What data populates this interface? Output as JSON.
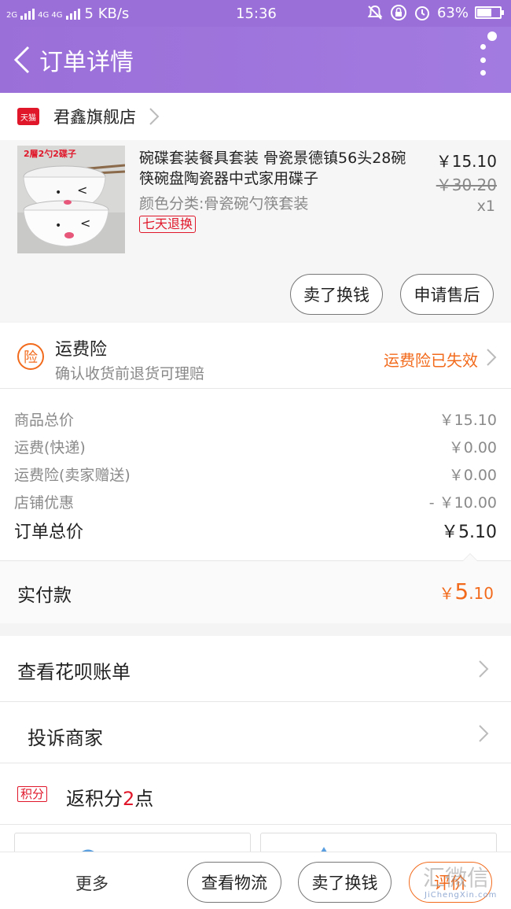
{
  "status_bar": {
    "network_a": "2G",
    "network_b": "4G 4G",
    "speed": "5 KB/s",
    "time": "15:36",
    "battery": "63%",
    "battery_level": 0.63
  },
  "header": {
    "title": "订单详情"
  },
  "store": {
    "badge": "天猫",
    "name": "君鑫旗舰店"
  },
  "product": {
    "title": "碗碟套装餐具套装 骨瓷景德镇56头28碗筷碗盘陶瓷器中式家用碟子",
    "sku": "颜色分类:骨瓷碗勺筷套装",
    "tag": "七天退换",
    "thumb_caption": "2層2勺2碟子",
    "price": "￥15.10",
    "original_price": "￥30.20",
    "quantity": "x1",
    "btn_sell": "卖了换钱",
    "btn_aftersale": "申请售后"
  },
  "insurance": {
    "icon": "险",
    "title": "运费险",
    "subtitle": "确认收货前退货可理赔",
    "status": "运费险已失效"
  },
  "summary": {
    "rows": [
      {
        "label": "商品总价",
        "value": "￥15.10"
      },
      {
        "label": "运费(快递)",
        "value": "￥0.00"
      },
      {
        "label": "运费险(卖家赠送)",
        "value": "￥0.00"
      },
      {
        "label": "店铺优惠",
        "value": "- ￥10.00"
      }
    ],
    "total_label": "订单总价",
    "total_value": "￥5.10"
  },
  "paid": {
    "label": "实付款",
    "currency": "￥",
    "int": "5",
    "dec": ".10"
  },
  "list": {
    "huabei": "查看花呗账单",
    "complain": "投诉商家",
    "jifen_badge": "积分",
    "jifen_pre": "返积分",
    "jifen_num": "2",
    "jifen_post": "点"
  },
  "bottom": {
    "more": "更多",
    "logistics": "查看物流",
    "sell": "卖了换钱",
    "rate": "评价"
  },
  "watermark": {
    "text": "汇微信",
    "sub": "JiChengXin.com"
  },
  "colors": {
    "accent": "#9b6fd8",
    "orange": "#f26b1d",
    "red": "#e0172a"
  }
}
